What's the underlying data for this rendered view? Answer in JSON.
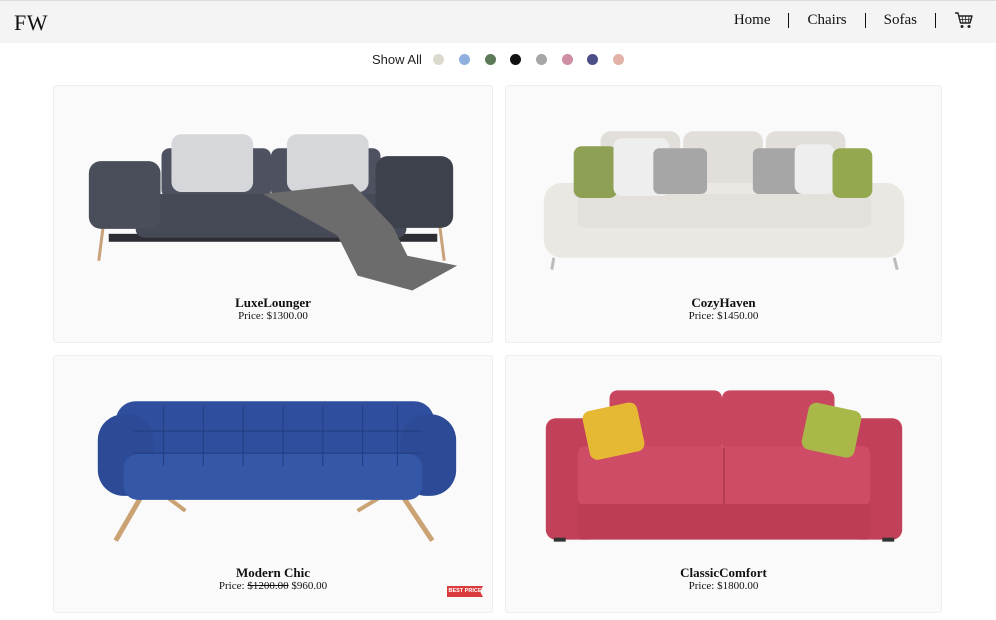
{
  "header": {
    "logo": "FW",
    "nav": {
      "home": "Home",
      "chairs": "Chairs",
      "sofas": "Sofas"
    },
    "cart_icon": "cart-icon"
  },
  "filters": {
    "show_all": "Show All",
    "colors": [
      {
        "name": "beige",
        "hex": "#dcd9ce"
      },
      {
        "name": "light-blue",
        "hex": "#8fb0df"
      },
      {
        "name": "green",
        "hex": "#5c7a58"
      },
      {
        "name": "black",
        "hex": "#111111"
      },
      {
        "name": "grey",
        "hex": "#a6a6a6"
      },
      {
        "name": "pink",
        "hex": "#cf8ea2"
      },
      {
        "name": "navy",
        "hex": "#4b4f86"
      },
      {
        "name": "peach",
        "hex": "#e2b2a6"
      }
    ]
  },
  "products": [
    {
      "name": "LuxeLounger",
      "price_label": "Price:",
      "price": "$1300.00",
      "color": "#4e5260"
    },
    {
      "name": "CozyHaven",
      "price_label": "Price:",
      "price": "$1450.00",
      "color": "#e9e6e1"
    },
    {
      "name": "Modern Chic",
      "price_label": "Price:",
      "old_price": "$1200.00",
      "price": "$960.00",
      "badge": "BEST PRICE",
      "color": "#2e4b9c"
    },
    {
      "name": "ClassicComfort",
      "price_label": "Price:",
      "price": "$1800.00",
      "color": "#c9465f"
    }
  ]
}
